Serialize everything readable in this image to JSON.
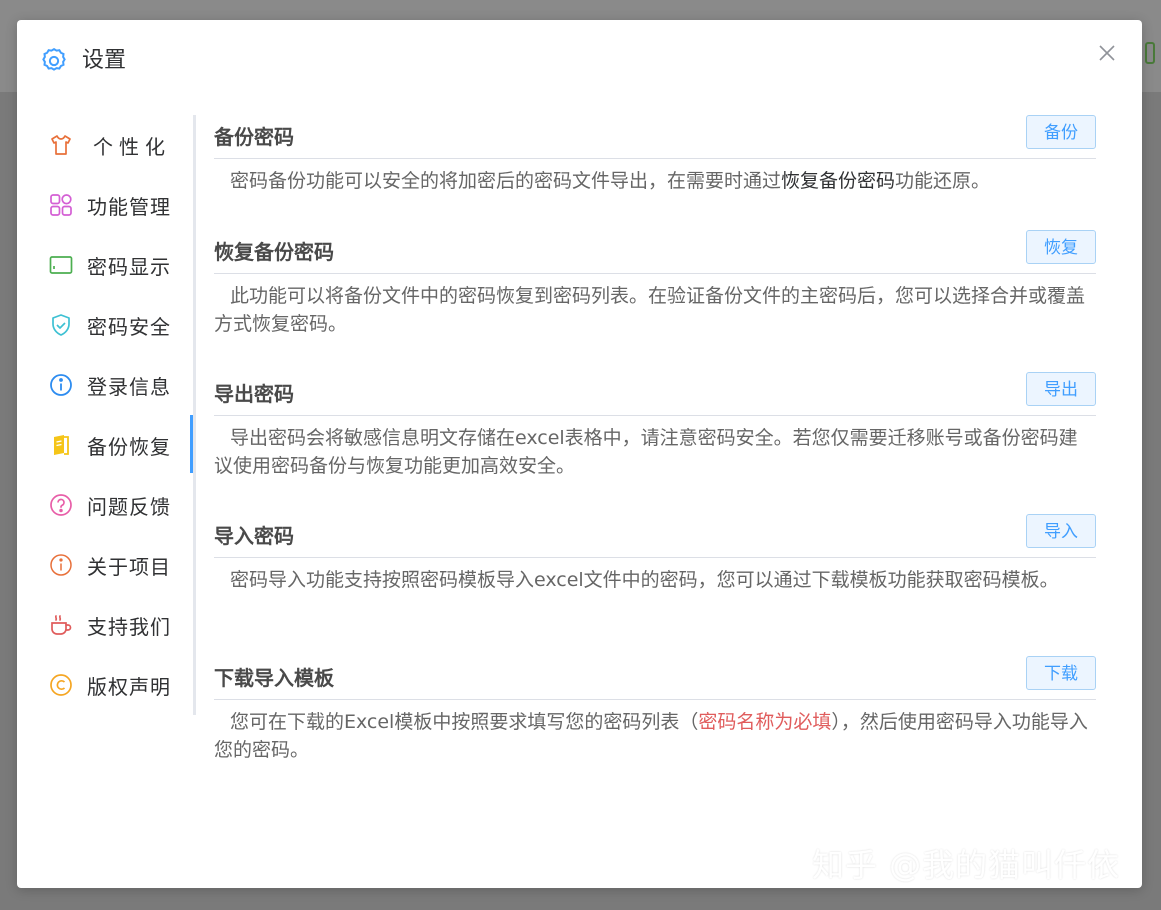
{
  "dialog": {
    "title": "设置",
    "title_icon": "gear-icon",
    "close_icon": "close-icon"
  },
  "sidebar": {
    "items": [
      {
        "label": "个性化",
        "icon": "shirt-icon",
        "color": "#e8703a"
      },
      {
        "label": "功能管理",
        "icon": "grid-icon",
        "color": "#d45fd4"
      },
      {
        "label": "密码显示",
        "icon": "screen-icon",
        "color": "#4caf50"
      },
      {
        "label": "密码安全",
        "icon": "shield-icon",
        "color": "#3ec1d3"
      },
      {
        "label": "登录信息",
        "icon": "info-icon",
        "color": "#2d8cf0"
      },
      {
        "label": "备份恢复",
        "icon": "book-icon",
        "color": "#f5c518",
        "active": true
      },
      {
        "label": "问题反馈",
        "icon": "question-icon",
        "color": "#e85ea8"
      },
      {
        "label": "关于项目",
        "icon": "about-icon",
        "color": "#e8703a"
      },
      {
        "label": "支持我们",
        "icon": "coffee-icon",
        "color": "#e05c5c"
      },
      {
        "label": "版权声明",
        "icon": "copyright-icon",
        "color": "#f5a623"
      }
    ]
  },
  "sections": [
    {
      "title": "备份密码",
      "button": "备份",
      "desc_pre": "密码备份功能可以安全的将加密后的密码文件导出，在需要时通过",
      "desc_strong": "恢复备份密码",
      "desc_post": "功能还原。"
    },
    {
      "title": "恢复备份密码",
      "button": "恢复",
      "desc": "此功能可以将备份文件中的密码恢复到密码列表。在验证备份文件的主密码后，您可以选择合并或覆盖方式恢复密码。"
    },
    {
      "title": "导出密码",
      "button": "导出",
      "desc": "导出密码会将敏感信息明文存储在excel表格中，请注意密码安全。若您仅需要迁移账号或备份密码建议使用密码备份与恢复功能更加高效安全。"
    },
    {
      "title": "导入密码",
      "button": "导入",
      "desc": "密码导入功能支持按照密码模板导入excel文件中的密码，您可以通过下载模板功能获取密码模板。"
    },
    {
      "title": "下载导入模板",
      "button": "下载",
      "desc_pre": "您可在下载的Excel模板中按照要求填写您的密码列表（",
      "desc_warn": "密码名称为必填",
      "desc_post": "），然后使用密码导入功能导入您的密码。"
    }
  ],
  "watermark": "知乎 @我的猫叫仟依",
  "colors": {
    "accent": "#409eff",
    "warn": "#e05c5c"
  }
}
